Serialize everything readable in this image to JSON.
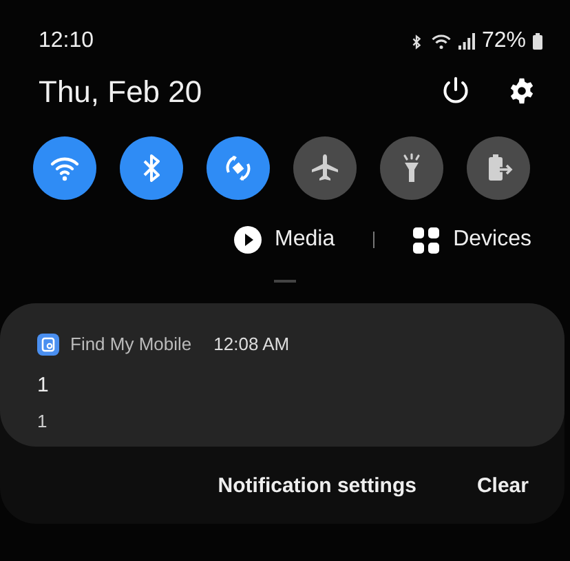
{
  "status_bar": {
    "time": "12:10",
    "battery": "72%"
  },
  "header": {
    "date": "Thu, Feb 20"
  },
  "quick_toggles": [
    {
      "kind": "wifi",
      "on": true
    },
    {
      "kind": "bluetooth",
      "on": true
    },
    {
      "kind": "rotate",
      "on": true
    },
    {
      "kind": "airplane",
      "on": false
    },
    {
      "kind": "flashlight",
      "on": false
    },
    {
      "kind": "battery-share",
      "on": false
    }
  ],
  "media_row": {
    "media": "Media",
    "devices": "Devices"
  },
  "notification": {
    "app": "Find My Mobile",
    "time": "12:08 AM",
    "title": "1",
    "text": "1"
  },
  "actions": [
    "Notification settings",
    "Clear"
  ]
}
